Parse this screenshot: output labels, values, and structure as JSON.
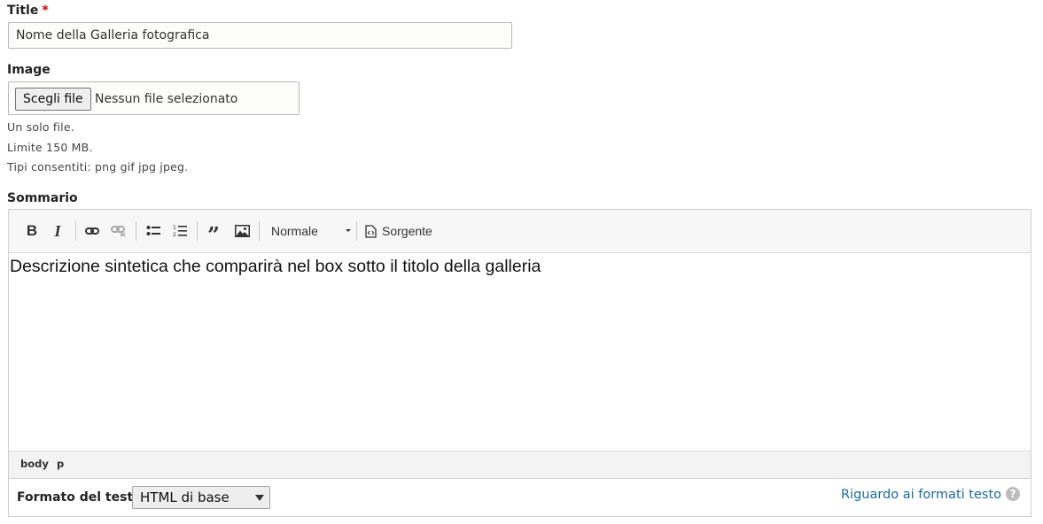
{
  "title_field": {
    "label": "Title",
    "required_marker": "*",
    "value": "Nome della Galleria fotografica"
  },
  "image_field": {
    "label": "Image",
    "button_label": "Scegli file",
    "status": "Nessun file selezionato",
    "descriptions": [
      "Un solo file.",
      "Limite 150 MB.",
      "Tipi consentiti: png gif jpg jpeg."
    ]
  },
  "summary_field": {
    "label": "Sommario",
    "toolbar": {
      "buttons": [
        "bold-icon",
        "italic-icon",
        "link-icon",
        "unlink-icon",
        "bulleted-list-icon",
        "numbered-list-icon",
        "blockquote-icon",
        "image-icon"
      ],
      "format_select": "Normale",
      "source_label": "Sorgente"
    },
    "content": "Descrizione sintetica che comparirà nel box sotto il titolo della galleria",
    "path": [
      "body",
      "p"
    ]
  },
  "text_format": {
    "label": "Formato del testo",
    "selected": "HTML di base",
    "about_link": "Riguardo ai formati testo",
    "help_icon": "?"
  },
  "colors": {
    "required": "#cc0000",
    "link": "#1a6a9a"
  }
}
